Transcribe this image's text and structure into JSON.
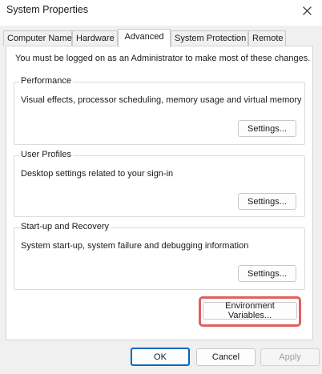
{
  "window": {
    "title": "System Properties"
  },
  "tabs": [
    {
      "label": "Computer Name",
      "active": false
    },
    {
      "label": "Hardware",
      "active": false
    },
    {
      "label": "Advanced",
      "active": true
    },
    {
      "label": "System Protection",
      "active": false
    },
    {
      "label": "Remote",
      "active": false
    }
  ],
  "advanced": {
    "admin_note": "You must be logged on as an Administrator to make most of these changes.",
    "performance": {
      "legend": "Performance",
      "description": "Visual effects, processor scheduling, memory usage and virtual memory",
      "settings_label": "Settings..."
    },
    "user_profiles": {
      "legend": "User Profiles",
      "description": "Desktop settings related to your sign-in",
      "settings_label": "Settings..."
    },
    "startup_recovery": {
      "legend": "Start-up and Recovery",
      "description": "System start-up, system failure and debugging information",
      "settings_label": "Settings..."
    },
    "environment_variables_label": "Environment Variables..."
  },
  "footer": {
    "ok_label": "OK",
    "cancel_label": "Cancel",
    "apply_label": "Apply"
  },
  "colors": {
    "highlight": "#e05f5f",
    "primary_border": "#0067c0"
  },
  "icons": {
    "close": "close-icon"
  }
}
